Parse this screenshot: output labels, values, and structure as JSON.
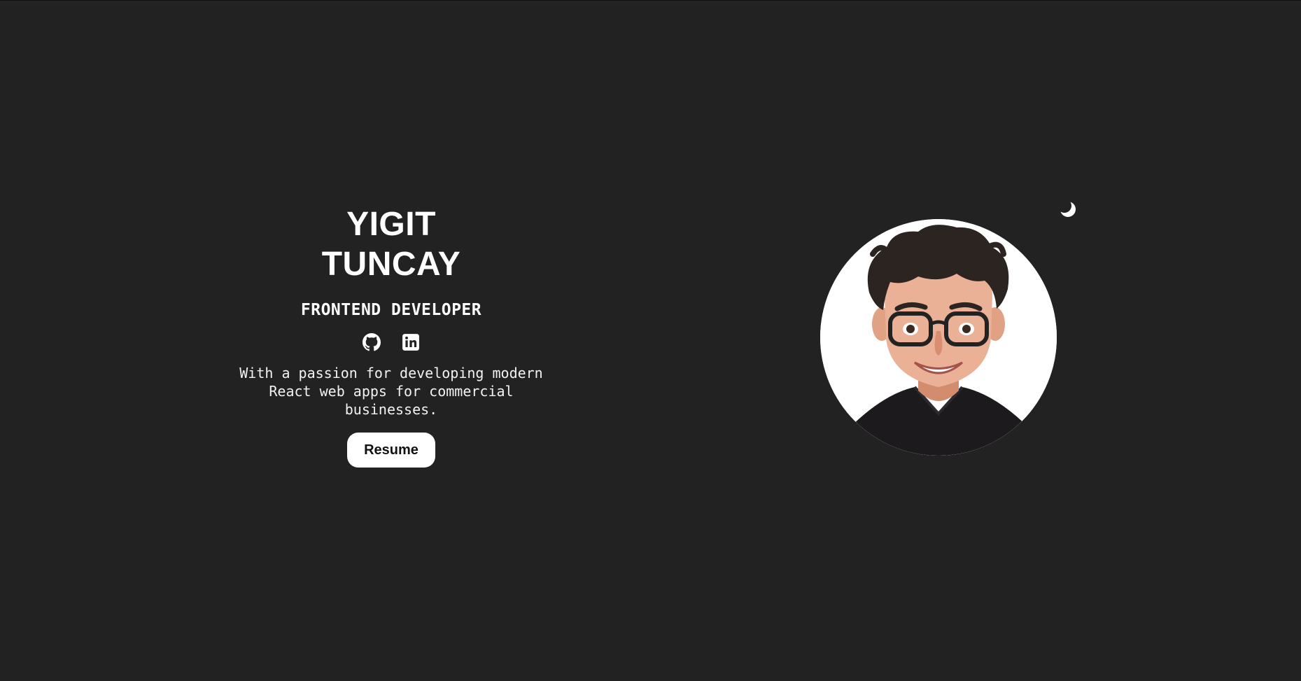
{
  "hero": {
    "first_name": "YIGIT",
    "last_name": "TUNCAY",
    "role": "FRONTEND DEVELOPER",
    "tagline": "With a passion for developing modern React web apps for commercial businesses.",
    "resume_label": "Resume"
  },
  "socials": [
    {
      "icon": "github-icon"
    },
    {
      "icon": "linkedin-icon"
    }
  ],
  "avatar": {
    "icon": "avatar-illustration"
  },
  "theme_toggle": {
    "icon": "moon-icon"
  },
  "colors": {
    "background": "#222222",
    "text": "#ffffff",
    "button_bg": "#ffffff",
    "button_text": "#111111"
  }
}
